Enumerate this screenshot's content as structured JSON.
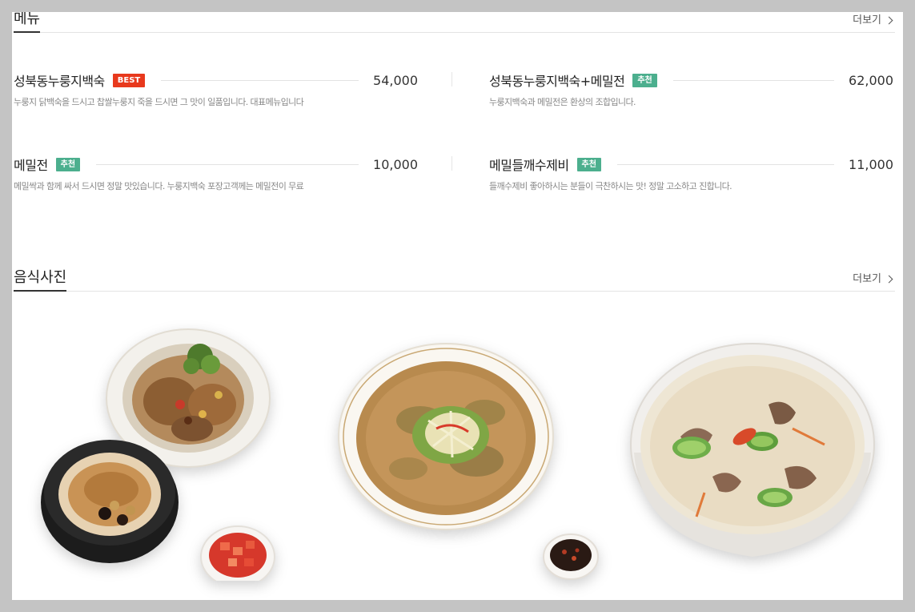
{
  "menu_section": {
    "title": "메뉴",
    "more_label": "더보기",
    "items": [
      {
        "name": "성북동누룽지백숙",
        "tag": "BEST",
        "price": "54,000",
        "desc": "누룽지 닭백숙을 드시고 찹쌀누룽지 죽을 드시면 그 맛이 일품입니다. 대표메뉴입니다"
      },
      {
        "name": "성북동누룽지백숙+메밀전",
        "tag": "추천",
        "price": "62,000",
        "desc": "누룽지백숙과 메밀전은 환상의 조합입니다."
      },
      {
        "name": "메밀전",
        "tag": "추천",
        "price": "10,000",
        "desc": "메밀싹과 함께 싸서 드시면 정말 맛있습니다. 누룽지백숙 포장고객께는 메밀전이 무료"
      },
      {
        "name": "메밀들깨수제비",
        "tag": "추천",
        "price": "11,000",
        "desc": "들깨수제비 좋아하시는 분들이 극찬하시는 맛! 정말 고소하고 진합니다."
      }
    ]
  },
  "photo_section": {
    "title": "음식사진",
    "more_label": "더보기",
    "photos": [
      {
        "name": "baeksuk-set-photo"
      },
      {
        "name": "buckwheat-pancake-photo"
      },
      {
        "name": "perilla-sujebi-photo"
      }
    ]
  },
  "colors": {
    "best_tag": "#e8391d",
    "recommend_tag": "#4caf8e",
    "background": "#c4c4c4"
  }
}
